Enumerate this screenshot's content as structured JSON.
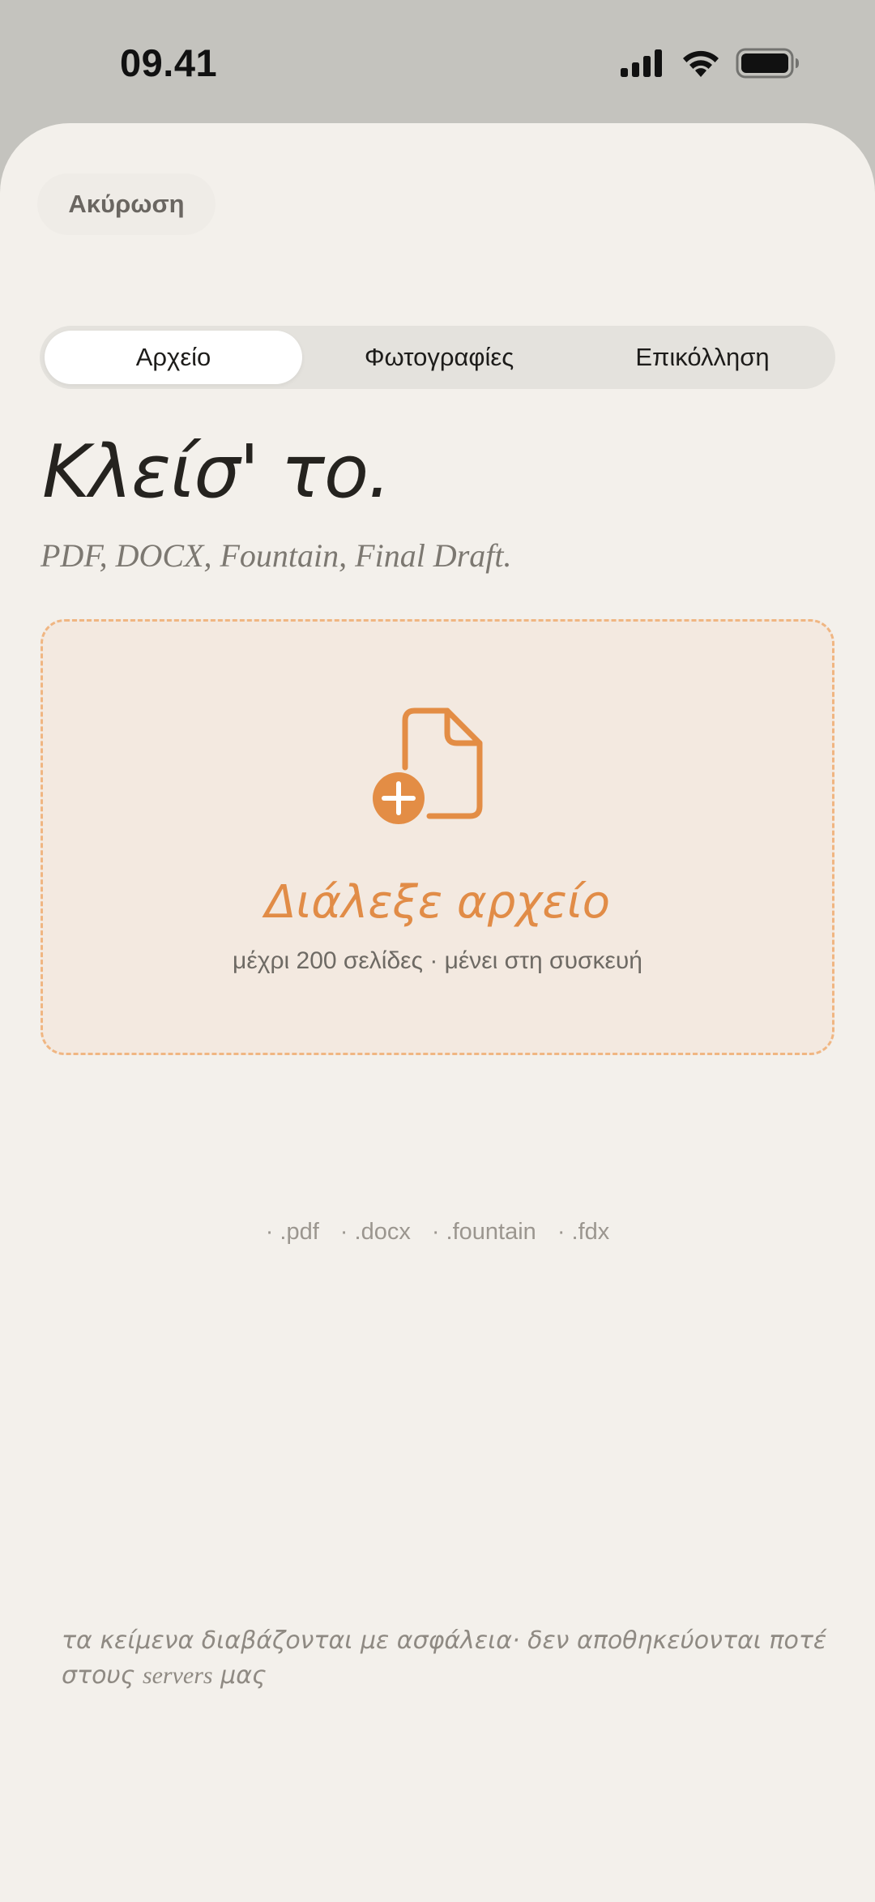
{
  "status_bar": {
    "time": "09.41",
    "icons": [
      "cellular-signal-icon",
      "wifi-icon",
      "battery-icon"
    ]
  },
  "header": {
    "cancel_label": "Ακύρωση"
  },
  "tabs": [
    {
      "label": "Αρχείο",
      "active": true
    },
    {
      "label": "Φωτογραφίες",
      "active": false
    },
    {
      "label": "Επικόλληση",
      "active": false
    }
  ],
  "main": {
    "title": "Κλείσ' το.",
    "subtitle": "PDF, DOCX, Fountain, Final Draft."
  },
  "dropzone": {
    "icon": "file-add-icon",
    "title": "Διάλεξε αρχείο",
    "subtitle": "μέχρι 200 σελίδες · μένει στη συσκευή"
  },
  "formats": [
    "· .pdf",
    "· .docx",
    "· .fountain",
    "· .fdx"
  ],
  "footer": {
    "note_part1": "τα κείμενα διαβάζονται με ασφάλεια· δεν αποθηκεύονται ποτέ στους ",
    "note_servers": "servers",
    "note_part2": " μας"
  },
  "colors": {
    "accent": "#E38D45",
    "sheet_background": "#F3F0EB",
    "dropzone_background": "#F3E9E0",
    "dropzone_border": "#F0B682",
    "top_background": "#C4C3BE"
  }
}
